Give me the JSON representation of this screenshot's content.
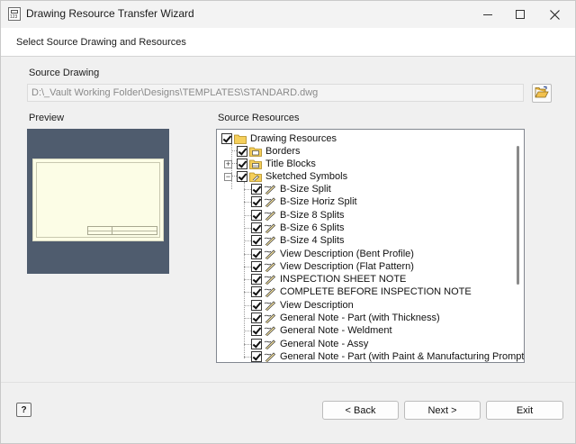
{
  "window": {
    "title": "Drawing Resource Transfer Wizard",
    "controls": {
      "minimize": "minimize-icon",
      "maximize": "maximize-icon",
      "close": "close-icon"
    }
  },
  "header": {
    "step_title": "Select Source Drawing and Resources"
  },
  "source_drawing": {
    "label": "Source Drawing",
    "path": "D:\\_Vault Working Folder\\Designs\\TEMPLATES\\STANDARD.dwg",
    "browse_icon": "open-folder-icon"
  },
  "preview": {
    "label": "Preview"
  },
  "resources": {
    "label": "Source Resources",
    "root": {
      "label": "Drawing Resources",
      "checked": true,
      "icon": "folder-icon"
    },
    "groups": [
      {
        "label": "Borders",
        "checked": true,
        "icon": "border-folder-icon",
        "expander": ""
      },
      {
        "label": "Title Blocks",
        "checked": true,
        "icon": "titleblock-folder-icon",
        "expander": "+"
      },
      {
        "label": "Sketched Symbols",
        "checked": true,
        "icon": "symbol-folder-icon",
        "expander": "−"
      }
    ],
    "symbols": [
      {
        "label": "B-Size Split",
        "checked": true
      },
      {
        "label": "B-Size Horiz Split",
        "checked": true
      },
      {
        "label": "B-Size 8 Splits",
        "checked": true
      },
      {
        "label": "B-Size 6 Splits",
        "checked": true
      },
      {
        "label": "B-Size 4 Splits",
        "checked": true
      },
      {
        "label": "View Description (Bent Profile)",
        "checked": true
      },
      {
        "label": "View Description (Flat Pattern)",
        "checked": true
      },
      {
        "label": "INSPECTION SHEET NOTE",
        "checked": true
      },
      {
        "label": "COMPLETE BEFORE INSPECTION NOTE",
        "checked": true
      },
      {
        "label": "View Description",
        "checked": true
      },
      {
        "label": "General Note - Part (with Thickness)",
        "checked": true
      },
      {
        "label": "General Note - Weldment",
        "checked": true
      },
      {
        "label": "General Note - Assy",
        "checked": true
      },
      {
        "label": "General Note - Part (with Paint & Manufacturing Prompt)",
        "checked": true
      }
    ]
  },
  "footer": {
    "help_label": "?",
    "back_label": "< Back",
    "next_label": "Next >",
    "exit_label": "Exit"
  }
}
